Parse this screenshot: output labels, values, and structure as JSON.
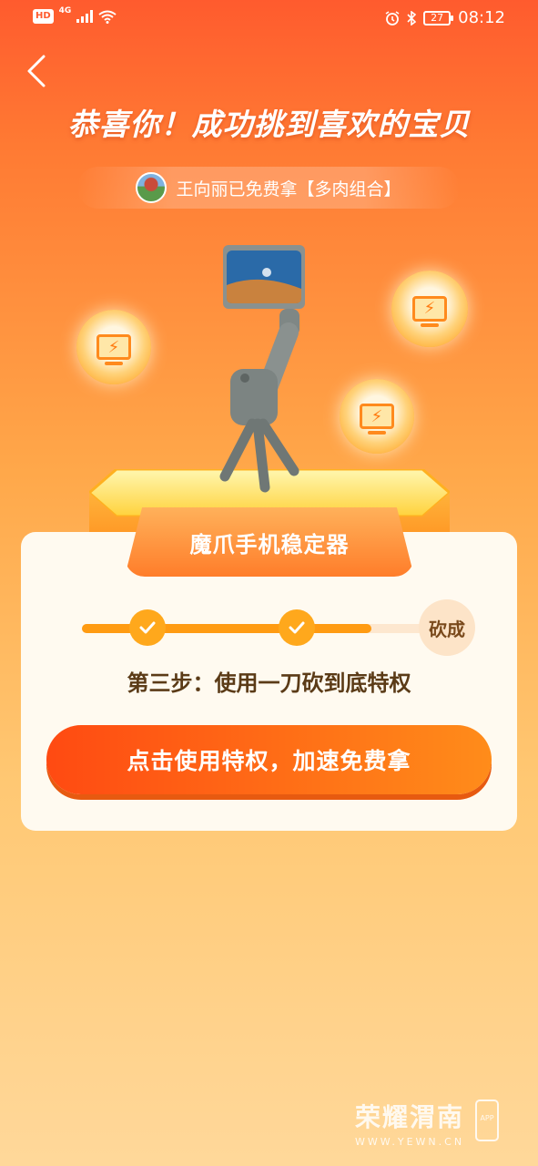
{
  "status_bar": {
    "hd": "HD",
    "network": "4G",
    "battery": "27",
    "time": "08:12"
  },
  "header": {
    "headline": "恭喜你！成功挑到喜欢的宝贝",
    "winner_text": "王向丽已免费拿【多肉组合】"
  },
  "product": {
    "name": "魔爪手机稳定器"
  },
  "progress": {
    "completed_steps": 2,
    "total_steps": 3,
    "fill_fraction": 0.74,
    "final_label": "砍成",
    "step_text": "第三步：使用一刀砍到底特权"
  },
  "cta": {
    "label": "点击使用特权，加速免费拿"
  },
  "watermark": {
    "name": "荣耀渭南",
    "url": "WWW.YEWN.CN",
    "app": "APP"
  },
  "colors": {
    "accent": "#ff7a33",
    "button": "#ff4a12",
    "progress": "#ff9b12"
  }
}
